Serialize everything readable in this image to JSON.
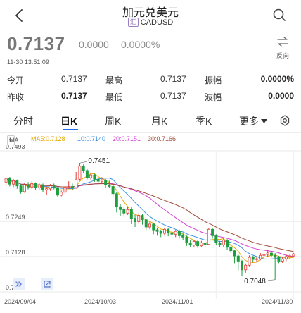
{
  "header": {
    "title": "加元兑美元",
    "market_badge": "汇",
    "symbol": "CADUSD"
  },
  "quote": {
    "price": "0.7137",
    "change": "0.0000",
    "change_pct": "0.0000%",
    "timestamp": "11-30 13:51:09",
    "reverse_label": "反向"
  },
  "stats": [
    [
      {
        "label": "今开",
        "value": "0.7137"
      },
      {
        "label": "最高",
        "value": "0.7137"
      },
      {
        "label": "振幅",
        "value": "0.0000%"
      }
    ],
    [
      {
        "label": "昨收",
        "value": "0.7137"
      },
      {
        "label": "最低",
        "value": "0.7137"
      },
      {
        "label": "波幅",
        "value": "0.0000"
      }
    ]
  ],
  "tabs": [
    {
      "label": "分时",
      "active": false
    },
    {
      "label": "日K",
      "active": true
    },
    {
      "label": "周K",
      "active": false
    },
    {
      "label": "月K",
      "active": false
    },
    {
      "label": "季K",
      "active": false
    },
    {
      "label": "更多",
      "active": false
    }
  ],
  "ma_indicator": {
    "selector": "MA",
    "ma5": "MA5:0.7128",
    "ma10": "10:0.7140",
    "ma20": "20:0.7151",
    "ma30": "30:0.7166"
  },
  "colors": {
    "up": "#e53935",
    "down": "#1e9e3e",
    "ma5": "#e6a700",
    "ma10": "#3b8fe0",
    "ma20": "#d33fd0",
    "ma30": "#9e4b3a",
    "accent": "#1a73e8"
  },
  "chart_data": {
    "type": "candlestick",
    "y_ticks": [
      "0.7493",
      "0.7249",
      "0.7128",
      "0.7006"
    ],
    "x_ticks": [
      "2024/09/04",
      "2024/10/03",
      "2024/11/01",
      "2024/11/30"
    ],
    "annotations": {
      "high": "0.7451",
      "low": "0.7048"
    },
    "ylim": [
      0.7006,
      0.7493
    ],
    "candles": [
      [
        0.7385,
        0.7398,
        0.7402,
        0.7372
      ],
      [
        0.7398,
        0.7378,
        0.7403,
        0.737
      ],
      [
        0.7378,
        0.739,
        0.7395,
        0.7368
      ],
      [
        0.739,
        0.7372,
        0.7394,
        0.7362
      ],
      [
        0.7372,
        0.7352,
        0.7378,
        0.7345
      ],
      [
        0.7352,
        0.7375,
        0.7381,
        0.7348
      ],
      [
        0.7375,
        0.7368,
        0.7385,
        0.736
      ],
      [
        0.7368,
        0.738,
        0.7388,
        0.7362
      ],
      [
        0.738,
        0.7365,
        0.7384,
        0.7358
      ],
      [
        0.7365,
        0.7376,
        0.7382,
        0.7358
      ],
      [
        0.7376,
        0.7358,
        0.738,
        0.735
      ],
      [
        0.7358,
        0.7362,
        0.7368,
        0.734
      ],
      [
        0.7362,
        0.7372,
        0.7378,
        0.7355
      ],
      [
        0.7372,
        0.7366,
        0.738,
        0.736
      ],
      [
        0.7366,
        0.734,
        0.737,
        0.7334
      ],
      [
        0.734,
        0.735,
        0.7356,
        0.7336
      ],
      [
        0.735,
        0.7368,
        0.7372,
        0.7345
      ],
      [
        0.7368,
        0.737,
        0.7388,
        0.7362
      ],
      [
        0.737,
        0.7366,
        0.738,
        0.7358
      ],
      [
        0.7366,
        0.7395,
        0.742,
        0.7362
      ],
      [
        0.7395,
        0.744,
        0.7451,
        0.739
      ],
      [
        0.744,
        0.7425,
        0.7446,
        0.7415
      ],
      [
        0.7425,
        0.74,
        0.743,
        0.7394
      ],
      [
        0.74,
        0.741,
        0.7418,
        0.7392
      ],
      [
        0.741,
        0.7395,
        0.7414,
        0.7386
      ],
      [
        0.7395,
        0.7388,
        0.74,
        0.738
      ],
      [
        0.7388,
        0.7392,
        0.7402,
        0.738
      ],
      [
        0.7392,
        0.7375,
        0.7396,
        0.7366
      ],
      [
        0.7375,
        0.737,
        0.739,
        0.7365
      ],
      [
        0.737,
        0.7345,
        0.7374,
        0.733
      ],
      [
        0.7345,
        0.73,
        0.735,
        0.728
      ],
      [
        0.73,
        0.729,
        0.731,
        0.7268
      ],
      [
        0.729,
        0.7278,
        0.7298,
        0.7265
      ],
      [
        0.7278,
        0.729,
        0.73,
        0.7272
      ],
      [
        0.729,
        0.726,
        0.7298,
        0.724
      ],
      [
        0.726,
        0.7248,
        0.7272,
        0.723
      ],
      [
        0.7248,
        0.727,
        0.7278,
        0.724
      ],
      [
        0.727,
        0.7255,
        0.7275,
        0.7238
      ],
      [
        0.7255,
        0.723,
        0.726,
        0.722
      ],
      [
        0.723,
        0.724,
        0.7248,
        0.7222
      ],
      [
        0.724,
        0.722,
        0.7245,
        0.7205
      ],
      [
        0.722,
        0.7215,
        0.7228,
        0.72
      ],
      [
        0.7215,
        0.7208,
        0.722,
        0.7195
      ],
      [
        0.7208,
        0.7222,
        0.7228,
        0.72
      ],
      [
        0.7222,
        0.721,
        0.7226,
        0.7198
      ],
      [
        0.721,
        0.7205,
        0.7215,
        0.7195
      ],
      [
        0.7205,
        0.7215,
        0.722,
        0.7195
      ],
      [
        0.7215,
        0.72,
        0.722,
        0.719
      ],
      [
        0.72,
        0.7195,
        0.721,
        0.7185
      ],
      [
        0.7195,
        0.7175,
        0.72,
        0.7165
      ],
      [
        0.7175,
        0.7168,
        0.7185,
        0.716
      ],
      [
        0.7168,
        0.718,
        0.7186,
        0.716
      ],
      [
        0.718,
        0.7165,
        0.7185,
        0.7158
      ],
      [
        0.7165,
        0.7175,
        0.7182,
        0.716
      ],
      [
        0.7175,
        0.717,
        0.718,
        0.7162
      ],
      [
        0.717,
        0.7222,
        0.7226,
        0.7168
      ],
      [
        0.7222,
        0.72,
        0.7228,
        0.719
      ],
      [
        0.72,
        0.7175,
        0.7205,
        0.7168
      ],
      [
        0.7175,
        0.7168,
        0.7182,
        0.716
      ],
      [
        0.7168,
        0.7185,
        0.719,
        0.7162
      ],
      [
        0.7185,
        0.716,
        0.7188,
        0.715
      ],
      [
        0.716,
        0.7148,
        0.7165,
        0.714
      ],
      [
        0.7148,
        0.713,
        0.7152,
        0.7105
      ],
      [
        0.713,
        0.7112,
        0.7136,
        0.708
      ],
      [
        0.7112,
        0.7082,
        0.7116,
        0.706
      ],
      [
        0.7082,
        0.7098,
        0.7104,
        0.7072
      ],
      [
        0.7098,
        0.7125,
        0.7132,
        0.7092
      ],
      [
        0.7125,
        0.7118,
        0.713,
        0.7108
      ],
      [
        0.7118,
        0.712,
        0.7126,
        0.711
      ],
      [
        0.712,
        0.7132,
        0.714,
        0.7115
      ],
      [
        0.7132,
        0.7135,
        0.7145,
        0.7125
      ],
      [
        0.7135,
        0.714,
        0.7152,
        0.7128
      ],
      [
        0.714,
        0.7132,
        0.7146,
        0.7125
      ],
      [
        0.7132,
        0.7125,
        0.714,
        0.7048
      ],
      [
        0.7125,
        0.7112,
        0.713,
        0.7105
      ],
      [
        0.7112,
        0.712,
        0.7126,
        0.7106
      ],
      [
        0.712,
        0.7128,
        0.7135,
        0.7112
      ],
      [
        0.7128,
        0.713,
        0.7136,
        0.712
      ],
      [
        0.713,
        0.7137,
        0.714,
        0.7125
      ]
    ]
  }
}
